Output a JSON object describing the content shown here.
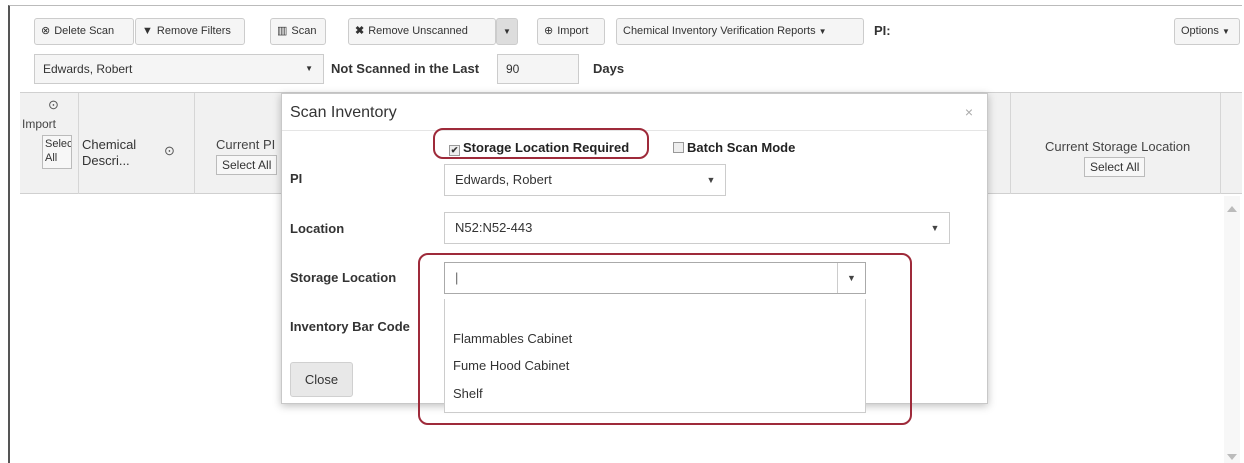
{
  "toolbar": {
    "delete_scan": "Delete Scan",
    "remove_filters": "Remove Filters",
    "scan": "Scan",
    "remove_unscanned": "Remove Unscanned",
    "import": "Import",
    "reports": "Chemical Inventory Verification Reports",
    "pi_label": "PI:",
    "options": "Options",
    "pi_value": "Edwards, Robert",
    "not_scanned_label": "Not Scanned in the Last",
    "days_value": "90",
    "days_label": "Days"
  },
  "grid": {
    "import_label": "Import",
    "select_all_overlay": "Select All",
    "chemical_desc": "Chemical Descri...",
    "current_pi": "Current PI",
    "select_all": "Select All",
    "current_storage_location": "Current Storage Location",
    "select_all_2": "Select All"
  },
  "modal": {
    "title": "Scan Inventory",
    "close_x": "×",
    "storage_required_label": "Storage Location Required",
    "storage_required_checked": true,
    "batch_scan_label": "Batch Scan Mode",
    "batch_scan_checked": false,
    "pi_label": "PI",
    "pi_value": "Edwards, Robert",
    "location_label": "Location",
    "location_value": "N52:N52-443",
    "storage_location_label": "Storage Location",
    "storage_location_value": "",
    "inventory_barcode_label": "Inventory Bar Code",
    "storage_options": [
      "Flammables Cabinet",
      "Fume Hood Cabinet",
      "Shelf"
    ],
    "close_button": "Close"
  },
  "colors": {
    "highlight": "#9e2a3a"
  }
}
